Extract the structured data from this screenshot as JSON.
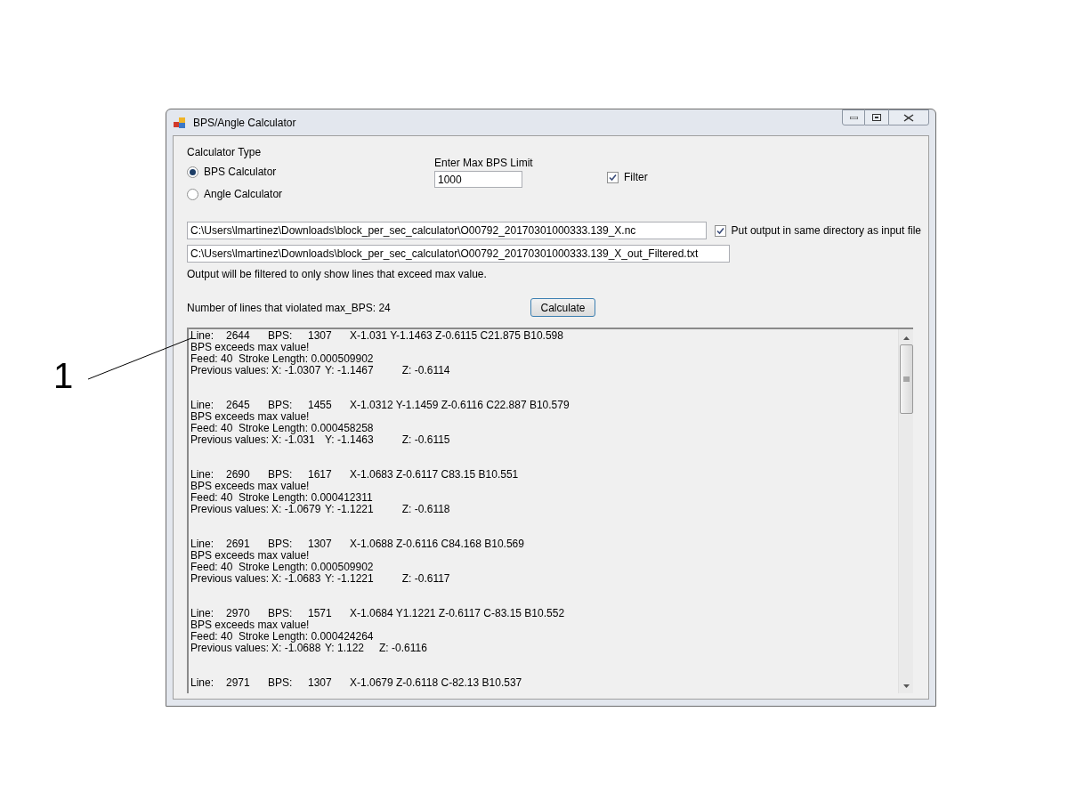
{
  "callout": {
    "label": "1"
  },
  "window": {
    "title": "BPS/Angle Calculator"
  },
  "calculator_type": {
    "label": "Calculator Type",
    "options": [
      {
        "label": "BPS Calculator",
        "selected": true
      },
      {
        "label": "Angle Calculator",
        "selected": false
      }
    ]
  },
  "max_bps": {
    "label": "Enter Max BPS Limit",
    "value": "1000"
  },
  "filter": {
    "label": "Filter",
    "checked": true
  },
  "input_path": "C:\\Users\\lmartinez\\Downloads\\block_per_sec_calculator\\O00792_20170301000333.139_X.nc",
  "same_directory": {
    "label": "Put output in same directory as input file",
    "checked": true
  },
  "output_path": "C:\\Users\\lmartinez\\Downloads\\block_per_sec_calculator\\O00792_20170301000333.139_X_out_Filtered.txt",
  "filter_note": "Output will be filtered to only show lines that exceed max value.",
  "violations": "Number of lines that violated max_BPS: 24",
  "calculate_button": "Calculate",
  "output": [
    {
      "line_label": "Line:",
      "line": "2644",
      "bps_label": "BPS:",
      "bps": "1307",
      "coords": "X-1.031 Y-1.1463 Z-0.6115 C21.875 B10.598",
      "message": "BPS exceeds max value!",
      "feed": "Feed: 40  Stroke Length: 0.000509902",
      "previous": "Previous values:",
      "x": "X: -1.0307",
      "y": "Y: -1.1467",
      "z": "Z: -0.6114"
    },
    {
      "line_label": "Line:",
      "line": "2645",
      "bps_label": "BPS:",
      "bps": "1455",
      "coords": "X-1.0312 Y-1.1459 Z-0.6116 C22.887 B10.579",
      "message": "BPS exceeds max value!",
      "feed": "Feed: 40  Stroke Length: 0.000458258",
      "previous": "Previous values:",
      "x": "X: -1.031",
      "y": "Y: -1.1463",
      "z": "Z: -0.6115"
    },
    {
      "line_label": "Line:",
      "line": "2690",
      "bps_label": "BPS:",
      "bps": "1617",
      "coords": "X-1.0683 Z-0.6117 C83.15 B10.551",
      "message": "BPS exceeds max value!",
      "feed": "Feed: 40  Stroke Length: 0.000412311",
      "previous": "Previous values:",
      "x": "X: -1.0679",
      "y": "Y: -1.1221",
      "z": "Z: -0.6118"
    },
    {
      "line_label": "Line:",
      "line": "2691",
      "bps_label": "BPS:",
      "bps": "1307",
      "coords": "X-1.0688 Z-0.6116 C84.168 B10.569",
      "message": "BPS exceeds max value!",
      "feed": "Feed: 40  Stroke Length: 0.000509902",
      "previous": "Previous values:",
      "x": "X: -1.0683",
      "y": "Y: -1.1221",
      "z": "Z: -0.6117"
    },
    {
      "line_label": "Line:",
      "line": "2970",
      "bps_label": "BPS:",
      "bps": "1571",
      "coords": "X-1.0684 Y1.1221 Z-0.6117 C-83.15 B10.552",
      "message": "BPS exceeds max value!",
      "feed": "Feed: 40  Stroke Length: 0.000424264",
      "previous": "Previous values:",
      "x": "X: -1.0688",
      "y": "Y: 1.122",
      "z": "Z: -0.6116"
    },
    {
      "line_label": "Line:",
      "line": "2971",
      "bps_label": "BPS:",
      "bps": "1307",
      "coords": "X-1.0679 Z-0.6118 C-82.13 B10.537"
    }
  ]
}
